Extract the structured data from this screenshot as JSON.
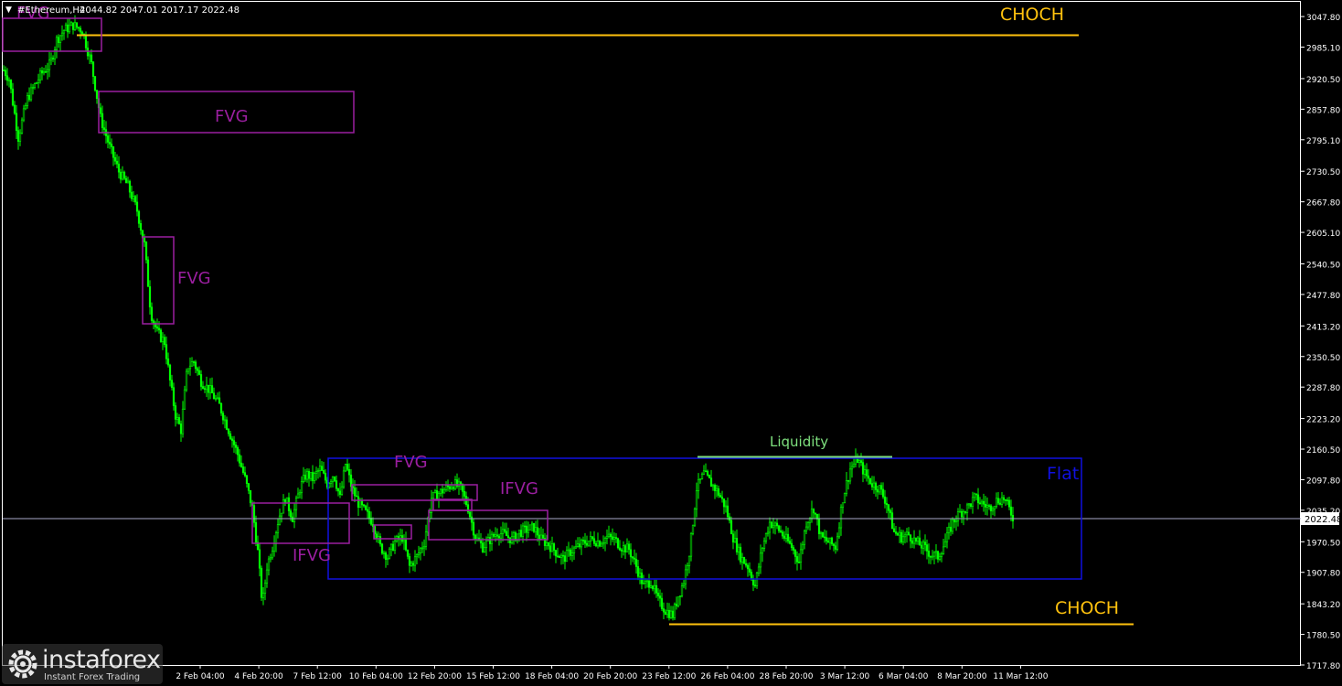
{
  "header": {
    "symbol_label": "#Ethereum,H4",
    "ohlc": "2044.82 2047.01 2017.17 2022.48"
  },
  "colors": {
    "background": "#000000",
    "candle": "#00ff00",
    "axis": "#ffffff",
    "fvg_box": "#9b1fa0",
    "fvg_text": "#9b1fa0",
    "choch": "#ffc20e",
    "flat_box": "#1010e0",
    "liquidity": "#7ee07e",
    "current_price_line": "#a8a8c8"
  },
  "chart_data": {
    "type": "candlestick",
    "timeframe": "H4",
    "ylim": [
      1717.8,
      3078.0
    ],
    "y_ticks": [
      "3047.80",
      "2985.10",
      "2920.50",
      "2857.80",
      "2795.10",
      "2730.50",
      "2667.80",
      "2605.10",
      "2540.50",
      "2477.80",
      "2413.20",
      "2350.50",
      "2287.80",
      "2223.20",
      "2160.50",
      "2097.80",
      "2035.20",
      "1970.50",
      "1907.80",
      "1843.20",
      "1780.50",
      "1717.80"
    ],
    "x_ticks": [
      "2 Feb 04:00",
      "4 Feb 20:00",
      "7 Feb 12:00",
      "10 Feb 04:00",
      "12 Feb 20:00",
      "15 Feb 12:00",
      "18 Feb 04:00",
      "20 Feb 20:00",
      "23 Feb 12:00",
      "26 Feb 04:00",
      "28 Feb 20:00",
      "3 Mar 12:00",
      "6 Mar 04:00",
      "8 Mar 20:00",
      "11 Mar 12:00"
    ],
    "current_price": "2022.48",
    "path_points": [
      [
        0,
        2950
      ],
      [
        10,
        2920
      ],
      [
        20,
        2800
      ],
      [
        30,
        2880
      ],
      [
        45,
        2930
      ],
      [
        55,
        2950
      ],
      [
        62,
        3000
      ],
      [
        70,
        3020
      ],
      [
        80,
        3030
      ],
      [
        90,
        3020
      ],
      [
        100,
        2950
      ],
      [
        110,
        2840
      ],
      [
        120,
        2780
      ],
      [
        130,
        2730
      ],
      [
        140,
        2700
      ],
      [
        150,
        2650
      ],
      [
        158,
        2580
      ],
      [
        165,
        2440
      ],
      [
        172,
        2400
      ],
      [
        180,
        2380
      ],
      [
        186,
        2300
      ],
      [
        192,
        2230
      ],
      [
        198,
        2200
      ],
      [
        205,
        2330
      ],
      [
        212,
        2340
      ],
      [
        220,
        2300
      ],
      [
        230,
        2280
      ],
      [
        240,
        2250
      ],
      [
        250,
        2200
      ],
      [
        260,
        2150
      ],
      [
        268,
        2100
      ],
      [
        276,
        2040
      ],
      [
        282,
        1950
      ],
      [
        287,
        1840
      ],
      [
        292,
        1920
      ],
      [
        298,
        1960
      ],
      [
        305,
        2020
      ],
      [
        312,
        2060
      ],
      [
        320,
        2020
      ],
      [
        328,
        2080
      ],
      [
        335,
        2110
      ],
      [
        342,
        2100
      ],
      [
        350,
        2120
      ],
      [
        358,
        2090
      ],
      [
        365,
        2110
      ],
      [
        372,
        2060
      ],
      [
        378,
        2130
      ],
      [
        385,
        2080
      ],
      [
        392,
        2050
      ],
      [
        400,
        2030
      ],
      [
        408,
        2010
      ],
      [
        416,
        1960
      ],
      [
        424,
        1940
      ],
      [
        432,
        1970
      ],
      [
        440,
        1980
      ],
      [
        448,
        1920
      ],
      [
        456,
        1940
      ],
      [
        464,
        1970
      ],
      [
        472,
        2060
      ],
      [
        480,
        2070
      ],
      [
        488,
        2080
      ],
      [
        496,
        2090
      ],
      [
        504,
        2080
      ],
      [
        512,
        2040
      ],
      [
        520,
        1980
      ],
      [
        528,
        1960
      ],
      [
        536,
        1975
      ],
      [
        544,
        1990
      ],
      [
        552,
        1985
      ],
      [
        560,
        1975
      ],
      [
        568,
        1990
      ],
      [
        576,
        1995
      ],
      [
        584,
        2000
      ],
      [
        592,
        1975
      ],
      [
        600,
        1965
      ],
      [
        608,
        1950
      ],
      [
        616,
        1935
      ],
      [
        624,
        1950
      ],
      [
        632,
        1960
      ],
      [
        640,
        1970
      ],
      [
        648,
        1975
      ],
      [
        656,
        1970
      ],
      [
        664,
        1980
      ],
      [
        672,
        1975
      ],
      [
        680,
        1960
      ],
      [
        688,
        1955
      ],
      [
        696,
        1920
      ],
      [
        704,
        1880
      ],
      [
        712,
        1890
      ],
      [
        720,
        1850
      ],
      [
        728,
        1830
      ],
      [
        736,
        1820
      ],
      [
        742,
        1860
      ],
      [
        748,
        1890
      ],
      [
        755,
        1960
      ],
      [
        762,
        2080
      ],
      [
        770,
        2110
      ],
      [
        778,
        2090
      ],
      [
        786,
        2070
      ],
      [
        794,
        2040
      ],
      [
        802,
        1980
      ],
      [
        810,
        1940
      ],
      [
        818,
        1920
      ],
      [
        826,
        1880
      ],
      [
        834,
        1960
      ],
      [
        842,
        2010
      ],
      [
        850,
        2000
      ],
      [
        858,
        1980
      ],
      [
        866,
        1960
      ],
      [
        874,
        1930
      ],
      [
        882,
        2010
      ],
      [
        890,
        2040
      ],
      [
        898,
        1980
      ],
      [
        906,
        1970
      ],
      [
        914,
        1960
      ],
      [
        922,
        2060
      ],
      [
        930,
        2120
      ],
      [
        938,
        2140
      ],
      [
        946,
        2110
      ],
      [
        954,
        2090
      ],
      [
        962,
        2080
      ],
      [
        970,
        2050
      ],
      [
        978,
        1990
      ],
      [
        986,
        1980
      ],
      [
        994,
        1985
      ],
      [
        1002,
        1970
      ],
      [
        1010,
        1960
      ],
      [
        1018,
        1945
      ],
      [
        1026,
        1940
      ],
      [
        1034,
        1970
      ],
      [
        1042,
        2010
      ],
      [
        1050,
        2030
      ],
      [
        1058,
        2040
      ],
      [
        1066,
        2060
      ],
      [
        1074,
        2050
      ],
      [
        1082,
        2040
      ],
      [
        1090,
        2055
      ],
      [
        1098,
        2060
      ],
      [
        1108,
        2022
      ]
    ]
  },
  "annotations": {
    "fvg_label": "FVG",
    "fvg_partial": "FVG",
    "ifvg_label": "IFVG",
    "choch_label": "CHOCH",
    "flat_label": "Flat",
    "liquidity_label": "Liquidity"
  },
  "watermark": {
    "logo_text": "instaforex",
    "subtitle": "Instant Forex Trading"
  }
}
